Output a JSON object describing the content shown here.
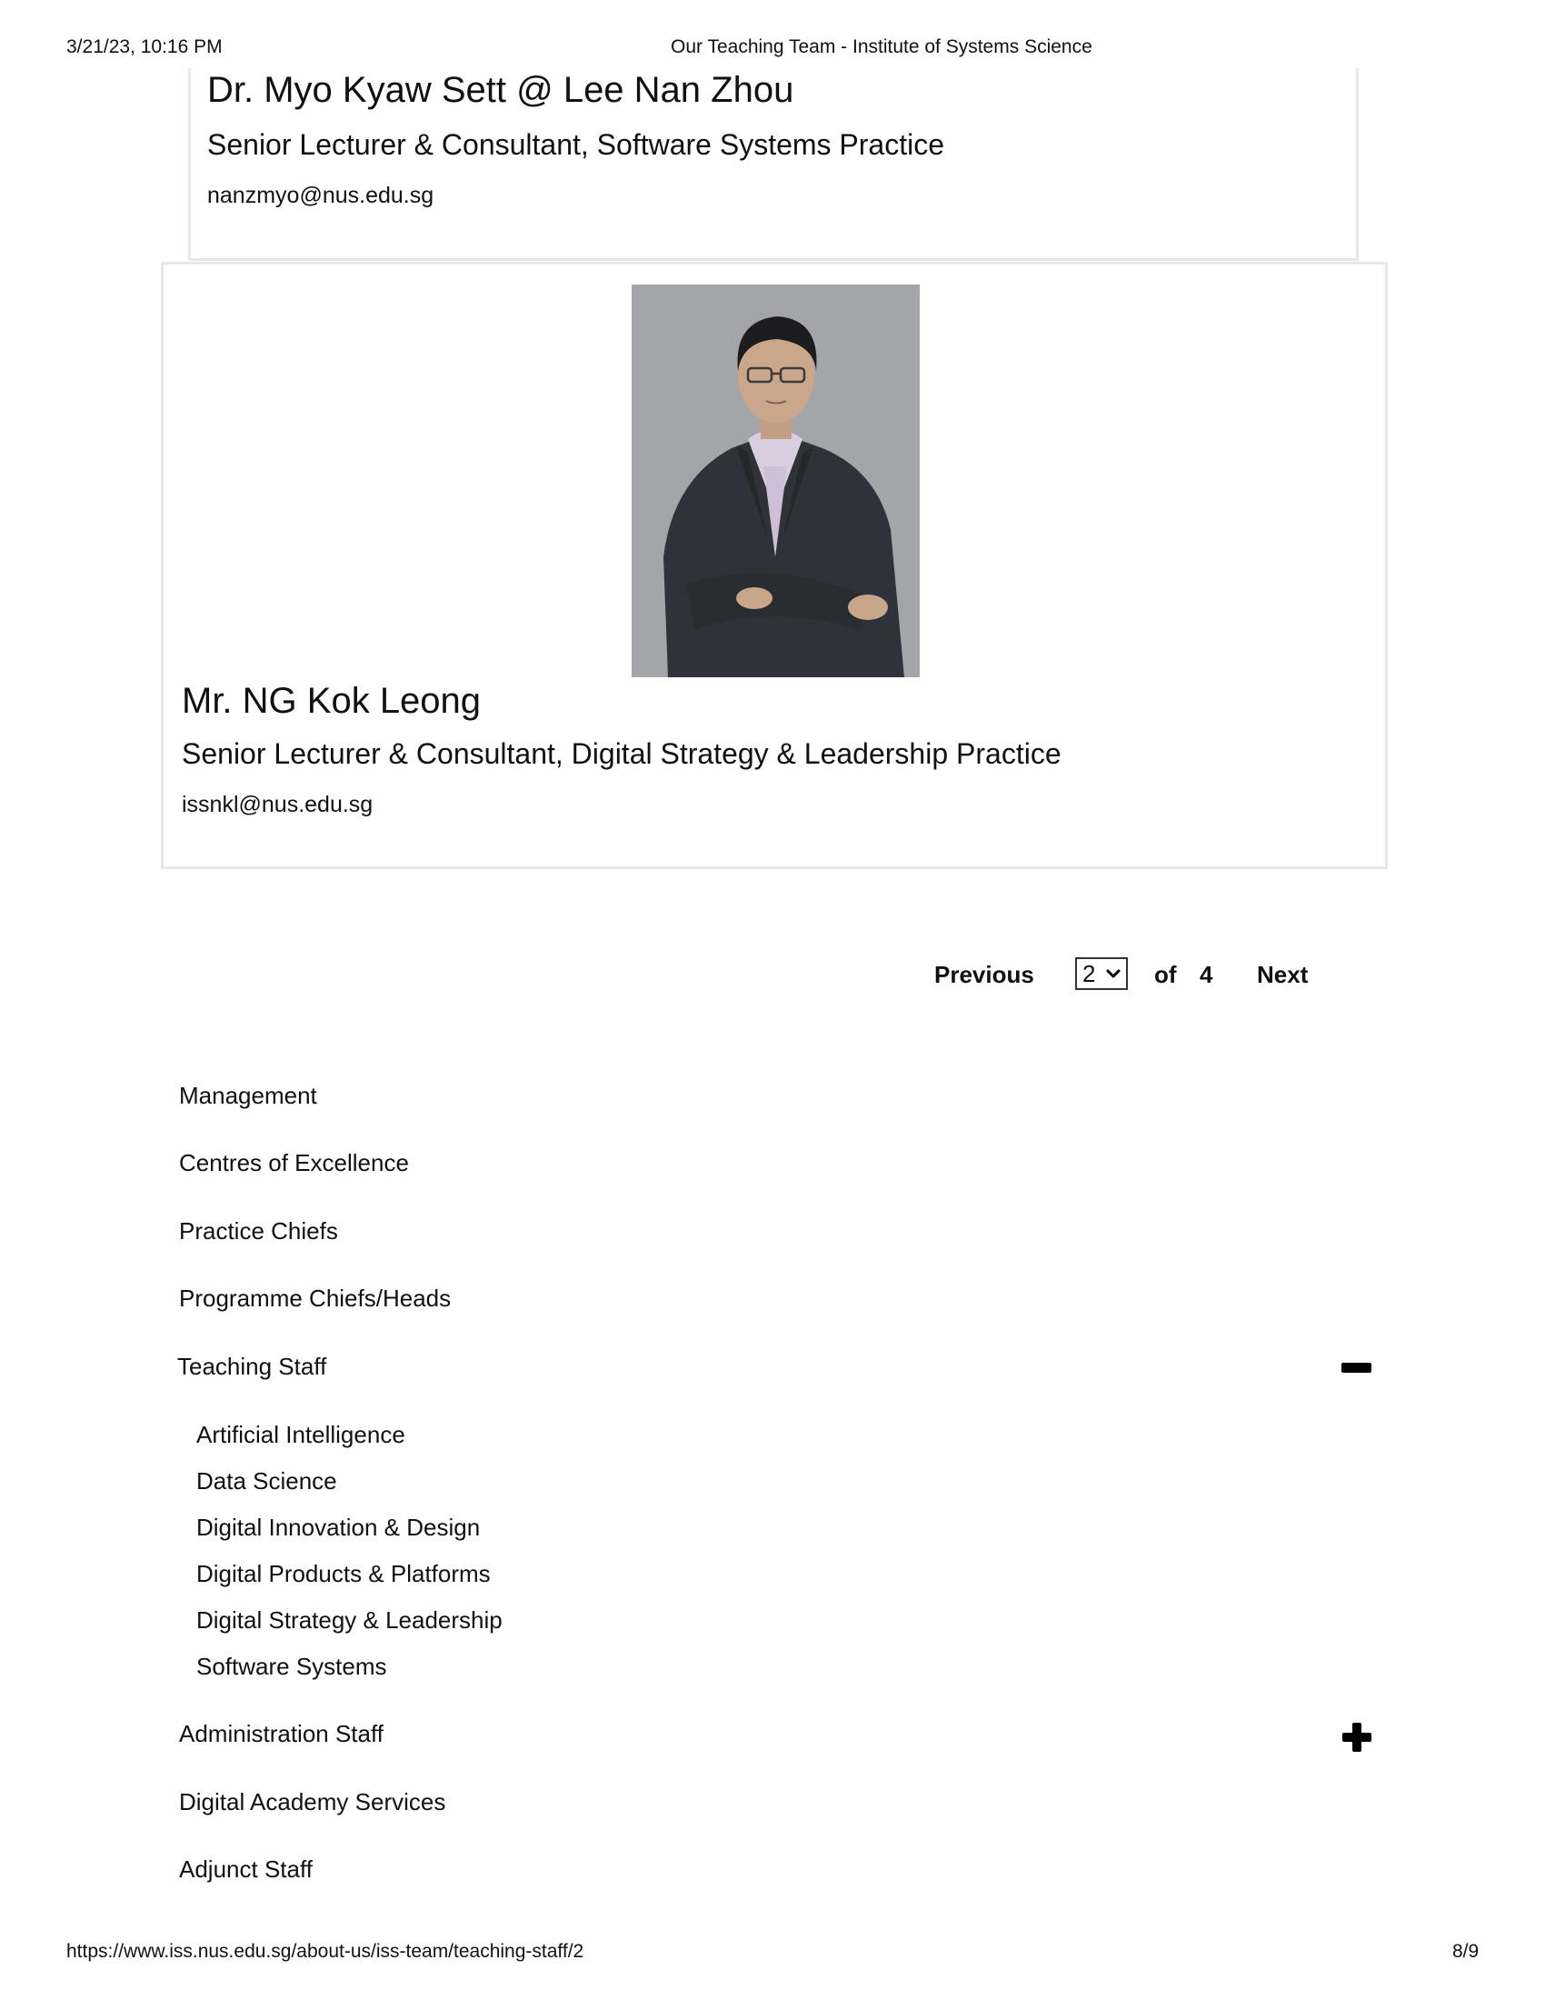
{
  "print_header": {
    "datetime": "3/21/23, 10:16 PM",
    "page_title": "Our Teaching Team - Institute of Systems Science"
  },
  "staff": [
    {
      "name": "Dr. Myo Kyaw Sett @ Lee Nan Zhou",
      "role": "Senior Lecturer & Consultant, Software Systems Practice",
      "email": "nanzmyo@nus.edu.sg"
    },
    {
      "name": "Mr. NG Kok Leong",
      "role": "Senior Lecturer & Consultant, Digital Strategy & Leadership Practice",
      "email": "issnkl@nus.edu.sg"
    }
  ],
  "pagination": {
    "previous_label": "Previous",
    "current_page": "2",
    "of_label": "of",
    "total_pages": "4",
    "next_label": "Next"
  },
  "categories": [
    {
      "label": "Management"
    },
    {
      "label": "Centres of Excellence"
    },
    {
      "label": "Practice Chiefs"
    },
    {
      "label": "Programme Chiefs/Heads"
    },
    {
      "label": "Teaching Staff",
      "expanded": true,
      "subitems": [
        "Artificial Intelligence",
        "Data Science",
        "Digital Innovation & Design",
        "Digital Products & Platforms",
        "Digital Strategy & Leadership",
        "Software Systems"
      ]
    },
    {
      "label": "Administration Staff",
      "expanded": false
    },
    {
      "label": "Digital Academy Services"
    },
    {
      "label": "Adjunct Staff"
    }
  ],
  "print_footer": {
    "url": "https://www.iss.nus.edu.sg/about-us/iss-team/teaching-staff/2",
    "page": "8/9"
  },
  "colors": {
    "card_border": "#e8e8e8",
    "text": "#111111",
    "photo_background": "#a4a5a9",
    "jacket": "#2f3238",
    "shirt": "#d9cde0"
  },
  "icons": {
    "select_arrow": "chevron-down-icon",
    "collapse": "minus-icon",
    "expand": "plus-icon"
  }
}
